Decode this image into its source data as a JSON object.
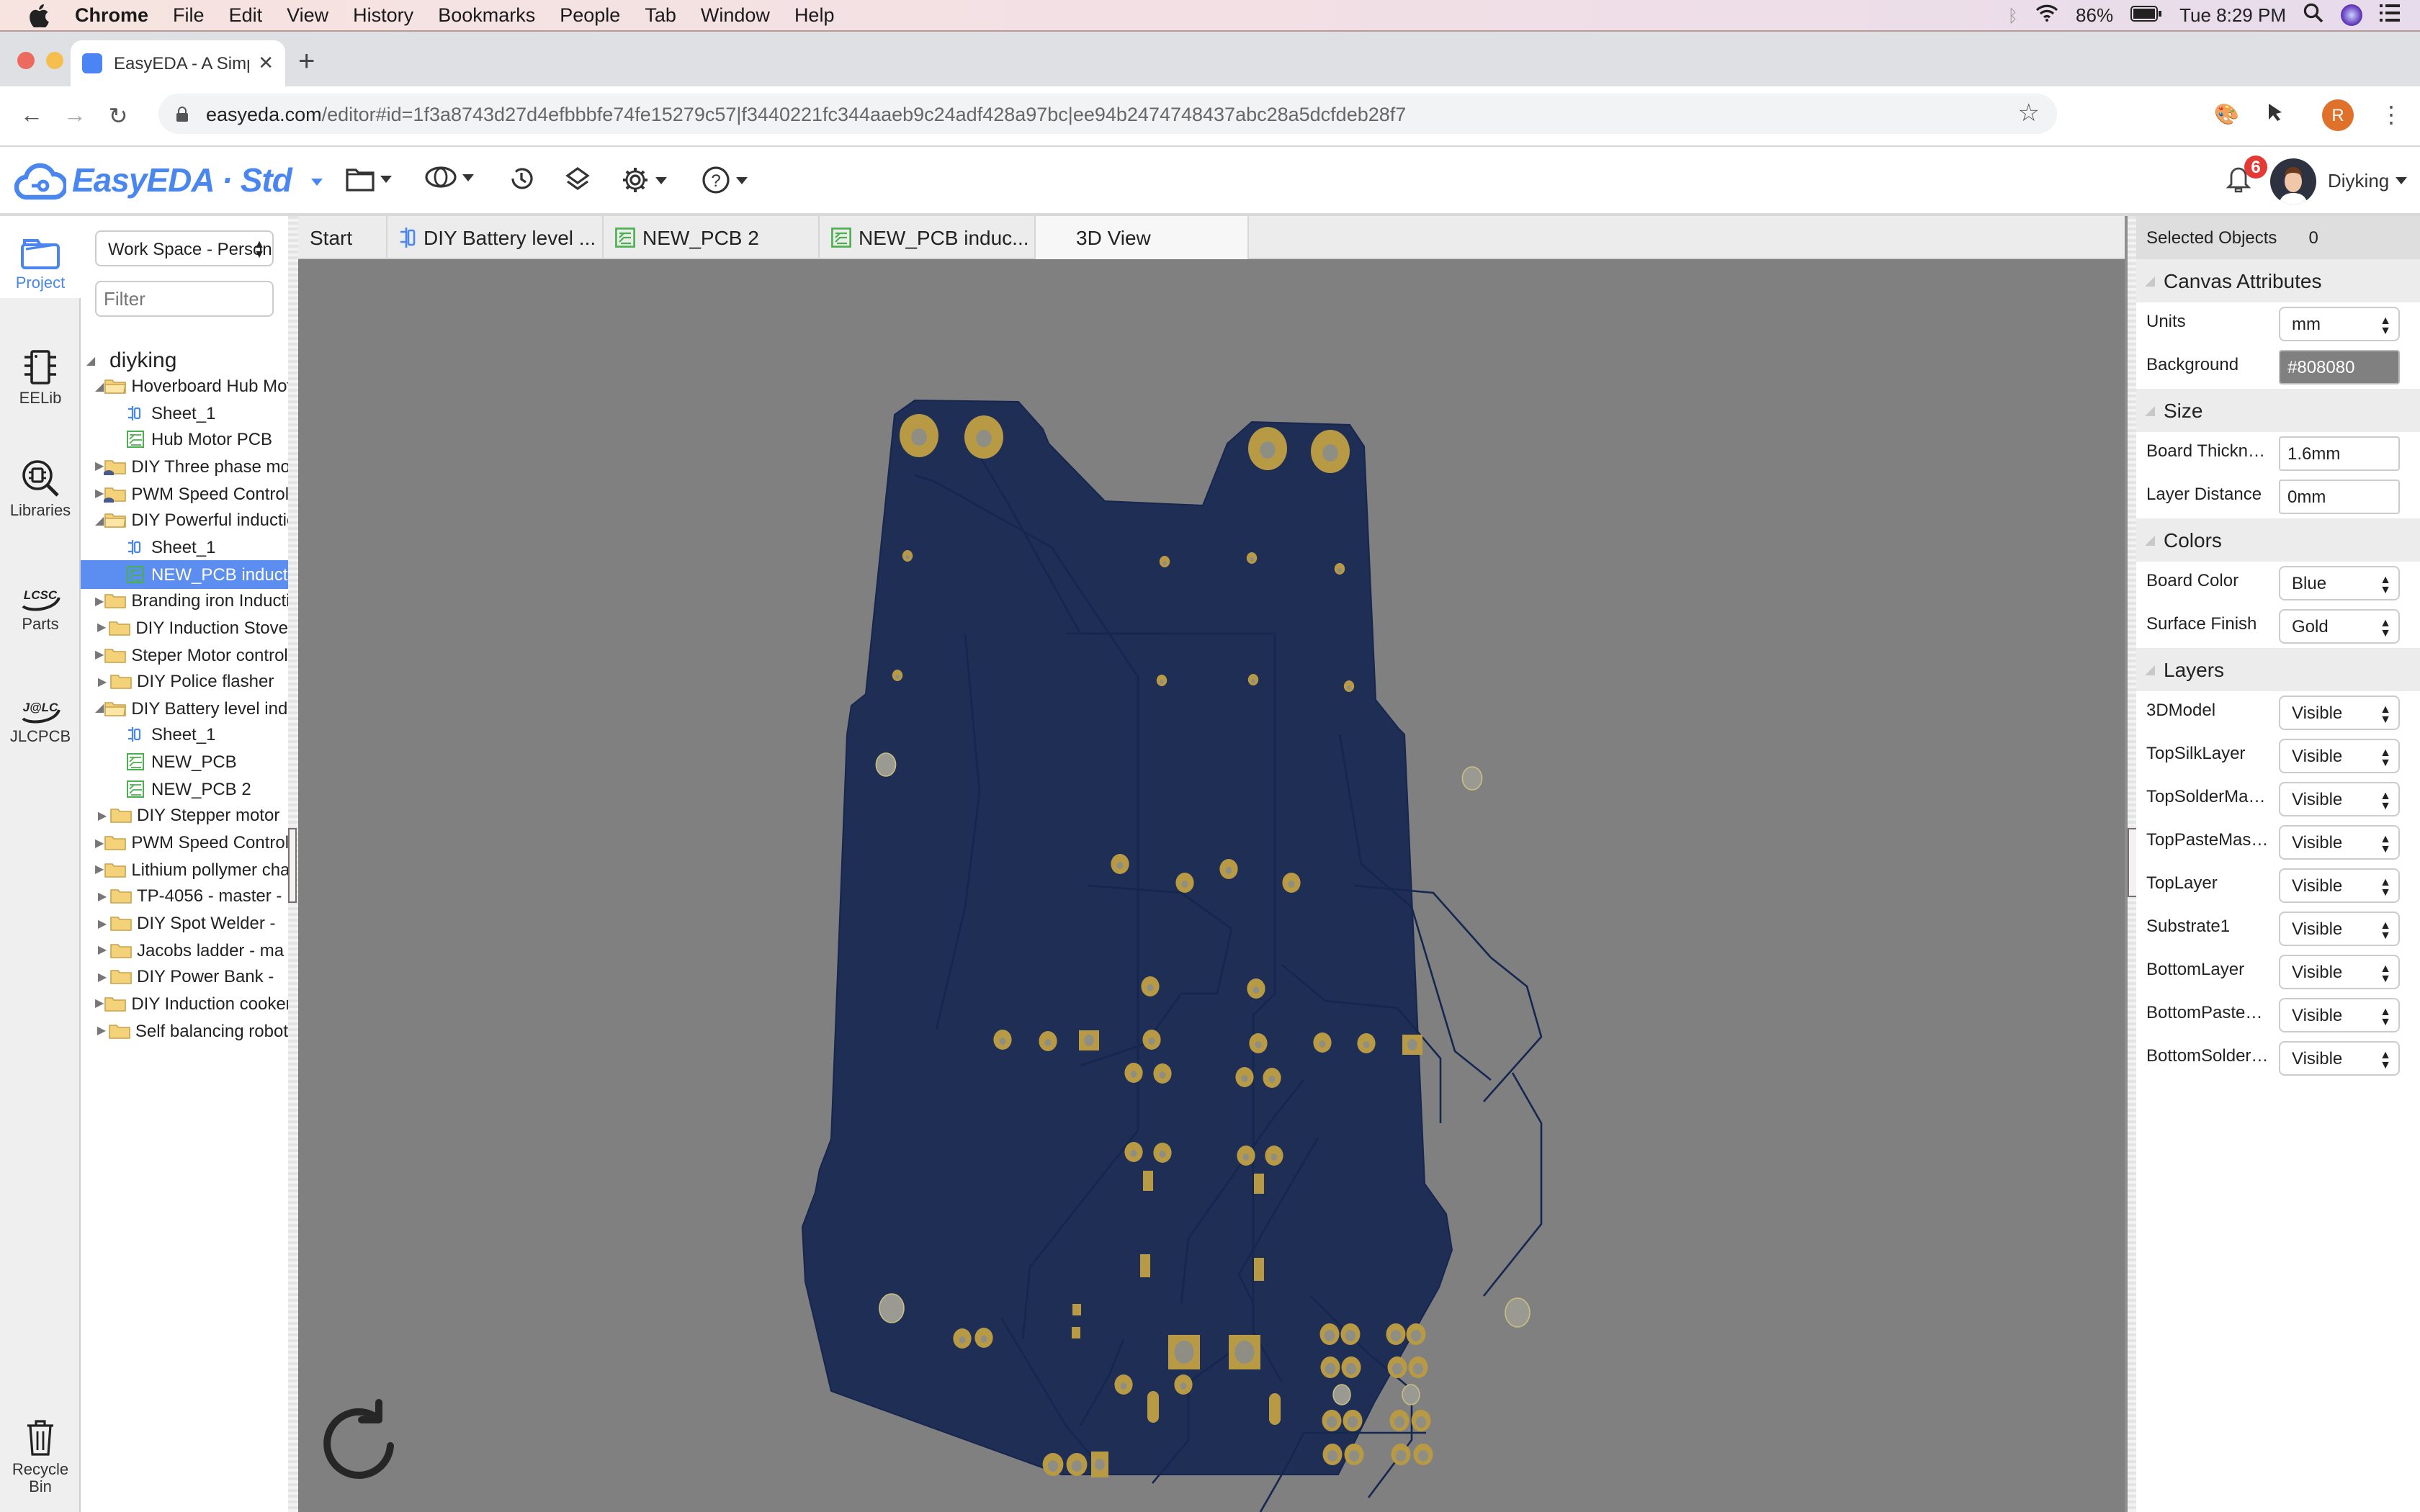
{
  "menubar": {
    "app": "Chrome",
    "items": [
      "File",
      "Edit",
      "View",
      "History",
      "Bookmarks",
      "People",
      "Tab",
      "Window",
      "Help"
    ],
    "battery": "86%",
    "clock": "Tue 8:29 PM"
  },
  "browser": {
    "tab_title": "EasyEDA - A Simple and Power",
    "url_host": "easyeda.com",
    "url_path": "/editor#id=1f3a8743d27d4efbbbfe74fe15279c57|f3440221fc344aaeb9c24adf428a97bc|ee94b2474748437abc28a5dcfdeb28f7",
    "profile_initial": "R"
  },
  "header": {
    "logo": "EasyEDA · Std",
    "notifications": "6",
    "username": "Diyking"
  },
  "rail": {
    "items": [
      {
        "label": "Project",
        "icon": "folder-icon"
      },
      {
        "label": "EELib",
        "icon": "chip-icon"
      },
      {
        "label": "Libraries",
        "icon": "library-search-icon"
      },
      {
        "label": "Parts",
        "icon": "lcsc-icon"
      },
      {
        "label": "JLCPCB",
        "icon": "jlc-icon"
      },
      {
        "label": "Recycle Bin",
        "icon": "trash-icon"
      }
    ]
  },
  "project": {
    "workspace": "Work Space - Personal",
    "filter_placeholder": "Filter",
    "tree": [
      {
        "label": "diyking",
        "type": "root",
        "level": 0,
        "expanded": true
      },
      {
        "label": "Hoverboard Hub Motor",
        "type": "folder",
        "level": 1,
        "expanded": true
      },
      {
        "label": "Sheet_1",
        "type": "schematic",
        "level": 2
      },
      {
        "label": "Hub Motor PCB",
        "type": "pcb",
        "level": 2
      },
      {
        "label": "DIY Three phase motor",
        "type": "shared-folder",
        "level": 1,
        "expanded": false
      },
      {
        "label": "PWM Speed Controller",
        "type": "shared-folder",
        "level": 1,
        "expanded": false
      },
      {
        "label": "DIY Powerful induction",
        "type": "folder",
        "level": 1,
        "expanded": true
      },
      {
        "label": "Sheet_1",
        "type": "schematic",
        "level": 2
      },
      {
        "label": "NEW_PCB induction",
        "type": "pcb",
        "level": 2,
        "selected": true
      },
      {
        "label": "Branding iron Induction",
        "type": "folder",
        "level": 1,
        "expanded": false
      },
      {
        "label": "DIY Induction Stove",
        "type": "folder",
        "level": 1,
        "expanded": false
      },
      {
        "label": "Steper Motor controller",
        "type": "folder",
        "level": 1,
        "expanded": false
      },
      {
        "label": "DIY Police flasher",
        "type": "folder",
        "level": 1,
        "expanded": false
      },
      {
        "label": "DIY Battery level indicator",
        "type": "folder",
        "level": 1,
        "expanded": true
      },
      {
        "label": "Sheet_1",
        "type": "schematic",
        "level": 2
      },
      {
        "label": "NEW_PCB",
        "type": "pcb",
        "level": 2
      },
      {
        "label": "NEW_PCB 2",
        "type": "pcb",
        "level": 2
      },
      {
        "label": "DIY Stepper motor",
        "type": "folder",
        "level": 1,
        "expanded": false
      },
      {
        "label": "PWM Speed Controller",
        "type": "folder",
        "level": 1,
        "expanded": false
      },
      {
        "label": "Lithium pollymer charger",
        "type": "folder",
        "level": 1,
        "expanded": false
      },
      {
        "label": "TP-4056 - master -",
        "type": "folder",
        "level": 1,
        "expanded": false
      },
      {
        "label": "DIY Spot Welder -",
        "type": "folder",
        "level": 1,
        "expanded": false
      },
      {
        "label": "Jacobs ladder - ma",
        "type": "folder",
        "level": 1,
        "expanded": false
      },
      {
        "label": "DIY Power Bank -",
        "type": "folder",
        "level": 1,
        "expanded": false
      },
      {
        "label": "DIY Induction cooker",
        "type": "folder",
        "level": 1,
        "expanded": false
      },
      {
        "label": "Self balancing robot",
        "type": "folder",
        "level": 1,
        "expanded": false
      }
    ]
  },
  "doc_tabs": [
    {
      "label": "Start",
      "type": "start"
    },
    {
      "label": "DIY Battery level ...",
      "type": "schematic"
    },
    {
      "label": "NEW_PCB 2",
      "type": "pcb"
    },
    {
      "label": "NEW_PCB induc...",
      "type": "pcb"
    },
    {
      "label": "3D View",
      "type": "3d",
      "active": true
    }
  ],
  "canvas": {
    "background": "#808080",
    "board_color": "#1e2e55",
    "pad_color": "#b89a45"
  },
  "properties": {
    "selected_objects_label": "Selected Objects",
    "selected_objects_value": "0",
    "sections": {
      "canvas": "Canvas Attributes",
      "size": "Size",
      "colors": "Colors",
      "layers": "Layers"
    },
    "units": {
      "label": "Units",
      "value": "mm"
    },
    "background": {
      "label": "Background",
      "value": "#808080"
    },
    "board_thickness": {
      "label": "Board Thickness",
      "value": "1.6mm"
    },
    "layer_distance": {
      "label": "Layer Distance",
      "value": "0mm"
    },
    "board_color": {
      "label": "Board Color",
      "value": "Blue"
    },
    "surface_finish": {
      "label": "Surface Finish",
      "value": "Gold"
    },
    "layers": [
      {
        "label": "3DModel",
        "value": "Visible"
      },
      {
        "label": "TopSilkLayer",
        "value": "Visible"
      },
      {
        "label": "TopSolderMaskLayer",
        "value": "Visible"
      },
      {
        "label": "TopPasteMaskLayer",
        "value": "Visible"
      },
      {
        "label": "TopLayer",
        "value": "Visible"
      },
      {
        "label": "Substrate1",
        "value": "Visible"
      },
      {
        "label": "BottomLayer",
        "value": "Visible"
      },
      {
        "label": "BottomPasteMaskLayer",
        "value": "Visible"
      },
      {
        "label": "BottomSolderMaskLayer",
        "value": "Visible"
      }
    ]
  }
}
